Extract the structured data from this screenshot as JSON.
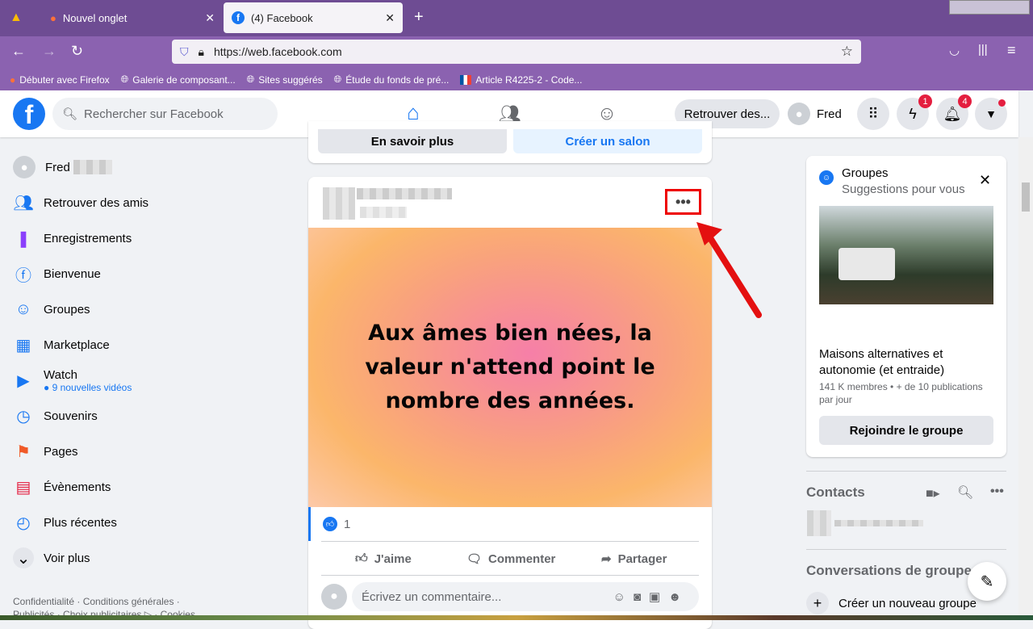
{
  "browser": {
    "tabs": [
      {
        "label": "Nouvel onglet",
        "icon": "firefox-icon"
      },
      {
        "label": "(4) Facebook",
        "icon": "facebook-icon",
        "active": true
      }
    ],
    "url": "https://web.facebook.com",
    "bookmarks": [
      "Débuter avec Firefox",
      "Galerie de composant...",
      "Sites suggérés",
      "Étude du fonds de pré...",
      "Article R4225-2 - Code..."
    ]
  },
  "header": {
    "search_placeholder": "Rechercher sur Facebook",
    "find_friends": "Retrouver des...",
    "user": "Fred",
    "messenger_badge": "1",
    "notifications_badge": "4",
    "accent": "#1877f2"
  },
  "sidebar": {
    "user": "Fred",
    "items": [
      {
        "label": "Retrouver des amis",
        "icon": "friends-icon"
      },
      {
        "label": "Enregistrements",
        "icon": "bookmark-icon"
      },
      {
        "label": "Bienvenue",
        "icon": "facebook-icon"
      },
      {
        "label": "Groupes",
        "icon": "groups-icon"
      },
      {
        "label": "Marketplace",
        "icon": "shop-icon"
      },
      {
        "label": "Watch",
        "icon": "watch-icon",
        "sub": "9 nouvelles vidéos"
      },
      {
        "label": "Souvenirs",
        "icon": "clock-icon"
      },
      {
        "label": "Pages",
        "icon": "flag-icon"
      },
      {
        "label": "Évènements",
        "icon": "calendar-icon"
      },
      {
        "label": "Plus récentes",
        "icon": "recent-icon"
      },
      {
        "label": "Voir plus",
        "icon": "chevron-down-icon"
      }
    ],
    "footer1": "Confidentialité · Conditions générales ·",
    "footer2": "Publicités · Choix publicitaires ▷ · Cookies"
  },
  "feed": {
    "prev_card": {
      "learn_more": "En savoir plus",
      "create_room": "Créer un salon"
    },
    "post": {
      "text": "Aux âmes bien nées, la valeur n'attend point le nombre des années.",
      "likes": "1",
      "like": "J'aime",
      "comment": "Commenter",
      "share": "Partager",
      "comment_placeholder": "Écrivez un commentaire..."
    }
  },
  "right": {
    "groups_title": "Groupes",
    "groups_sub": "Suggestions pour vous",
    "group_name": "Maisons alternatives et autonomie (et entraide)",
    "group_meta": "141 K membres • + de 10 publications par jour",
    "join": "Rejoindre le groupe",
    "contacts": "Contacts",
    "group_convos": "Conversations de groupe",
    "create_group": "Créer un nouveau groupe"
  }
}
